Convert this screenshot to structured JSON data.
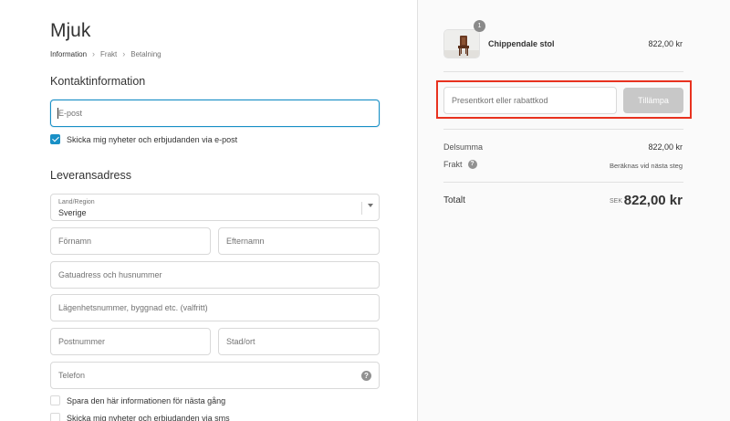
{
  "shop": {
    "title": "Mjuk"
  },
  "breadcrumb": {
    "items": [
      "Information",
      "Frakt",
      "Betalning"
    ]
  },
  "contact": {
    "title": "Kontaktinformation",
    "email_placeholder": "E-post",
    "newsletter_label": "Skicka mig nyheter och erbjudanden via e-post"
  },
  "shipping": {
    "title": "Leveransadress",
    "country_label": "Land/Region",
    "country_value": "Sverige",
    "first_name": "Förnamn",
    "last_name": "Efternamn",
    "address": "Gatuadress och husnummer",
    "apartment": "Lägenhetsnummer, byggnad etc. (valfritt)",
    "postal_code": "Postnummer",
    "city": "Stad/ort",
    "phone": "Telefon",
    "help_glyph": "?",
    "save_info_label": "Spara den här informationen för nästa gång",
    "sms_label": "Skicka mig nyheter och erbjudanden via sms"
  },
  "summary": {
    "product": {
      "name": "Chippendale stol",
      "price": "822,00 kr",
      "quantity": "1"
    },
    "discount": {
      "placeholder": "Presentkort eller rabattkod",
      "button": "Tillämpa"
    },
    "subtotal": {
      "label": "Delsumma",
      "value": "822,00 kr"
    },
    "shipping": {
      "label": "Frakt",
      "value": "Beräknas vid nästa steg",
      "help_glyph": "?"
    },
    "total": {
      "label": "Totalt",
      "currency": "SEK",
      "value": "822,00 kr"
    }
  },
  "colors": {
    "accent": "#1990c6",
    "highlight": "#e8321f",
    "button_disabled": "#c8c8c8"
  },
  "icons": {
    "breadcrumb_sep": "chevron-right-icon",
    "select": "chevron-down-icon",
    "help": "question-circle-icon",
    "check": "checkmark-icon"
  }
}
